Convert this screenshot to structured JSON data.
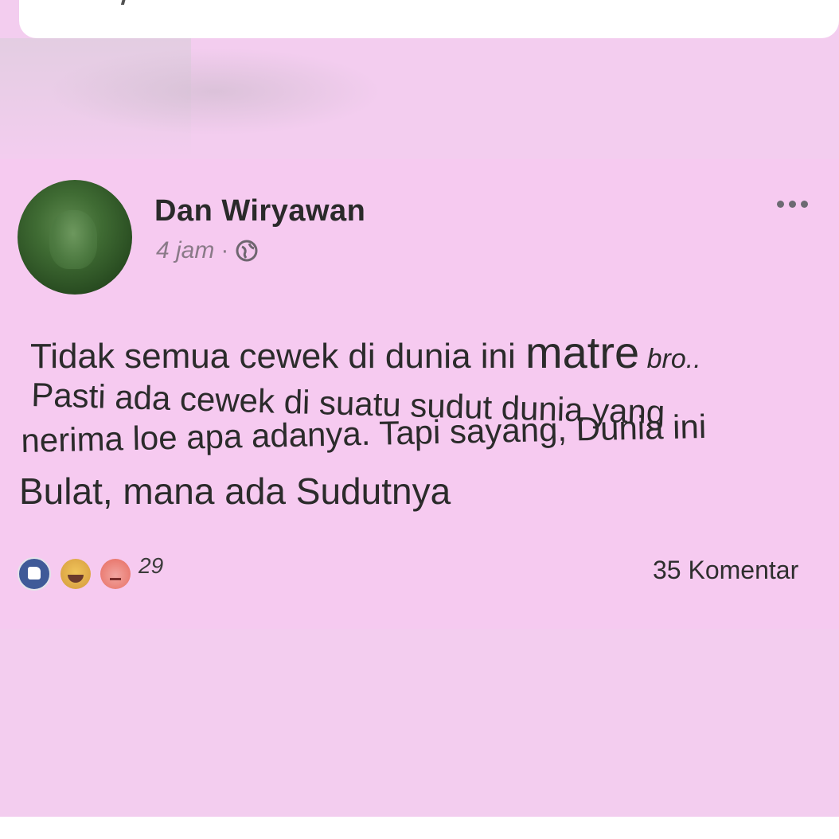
{
  "post": {
    "author": "Dan Wiryawan",
    "time": "4 jam",
    "separator": "·",
    "text_lines": [
      [
        "Tidak semua cewek di dunia ini ",
        "matre",
        " bro.."
      ],
      [
        "Pasti ada cewek di suatu sudut dunia yang"
      ],
      [
        "nerima loe apa adanya. Tapi sayang, Dunia ini"
      ],
      [
        "Bulat, mana ada Sudutnya"
      ]
    ],
    "reaction_count": "29",
    "comment_count": "35 Komentar"
  },
  "icons": {
    "more": "more-options-icon",
    "privacy": "globe-icon",
    "reactions": [
      "like-icon",
      "haha-icon",
      "angry-icon"
    ]
  },
  "colors": {
    "background": "#f3cdef",
    "post_background": "#f6caf0",
    "text": "#2b2b2b",
    "like": "#3f5a98"
  }
}
